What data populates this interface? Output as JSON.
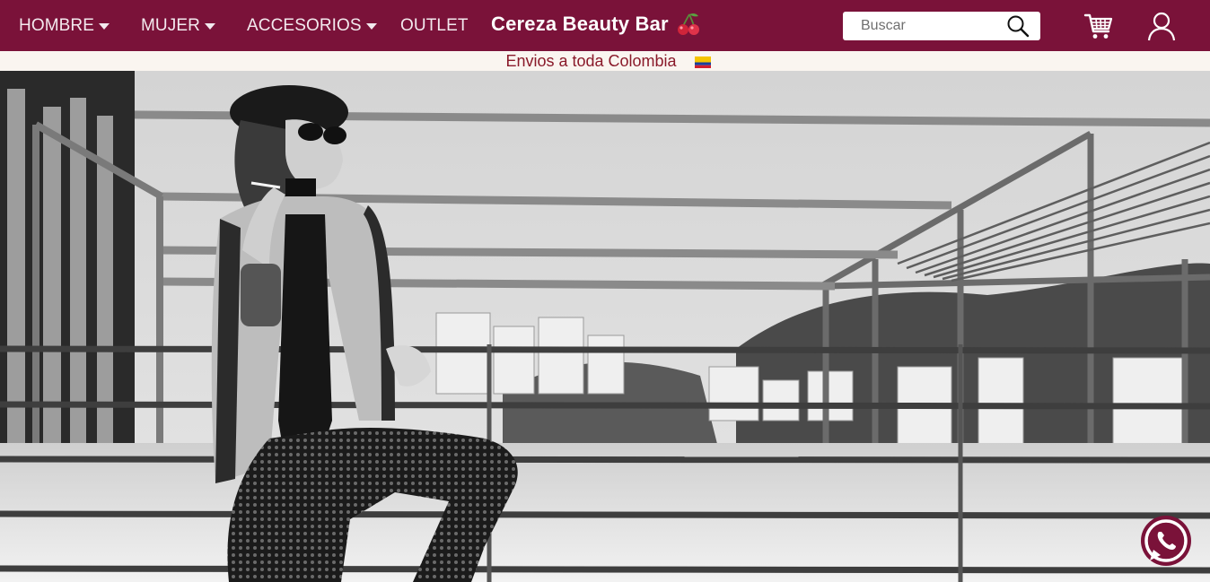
{
  "nav": {
    "items": [
      {
        "label": "HOMBRE",
        "has_dropdown": true
      },
      {
        "label": "MUJER",
        "has_dropdown": true
      },
      {
        "label": "ACCESORIOS",
        "has_dropdown": true
      },
      {
        "label": "OUTLET",
        "has_dropdown": false
      }
    ]
  },
  "brand": {
    "name": "Cereza Beauty Bar",
    "icon": "cherry-icon"
  },
  "search": {
    "placeholder": "Buscar",
    "value": "",
    "icon": "search-icon"
  },
  "header_icons": {
    "cart": "cart-icon",
    "account": "user-icon"
  },
  "shipping_banner": {
    "text": "Envios a toda Colombia",
    "flag_icon": "colombia-flag-icon"
  },
  "floating": {
    "whatsapp_icon": "whatsapp-icon"
  },
  "colors": {
    "topbar": "#7a1239",
    "shipbar_bg": "#faf5f0",
    "shipbar_text": "#8a1a2a",
    "whatsapp_ring": "#7a1239"
  }
}
